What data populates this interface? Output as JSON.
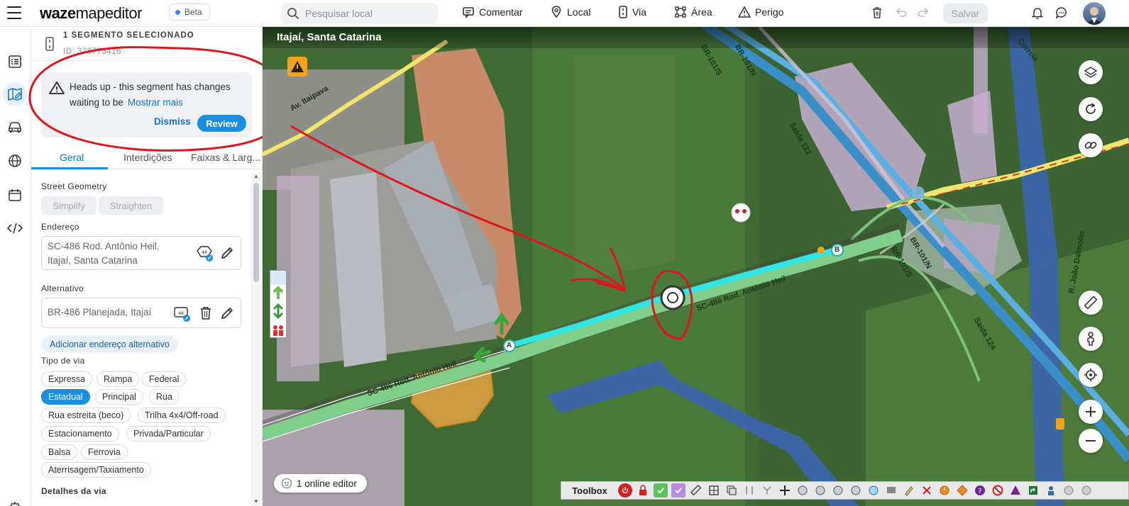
{
  "app": {
    "logo_bold": "waze",
    "logo_light": "mapeditor",
    "beta_label": "Beta"
  },
  "toolbar": {
    "search_placeholder": "Pesquisar local",
    "comment": "Comentar",
    "place": "Local",
    "road": "Via",
    "area": "Área",
    "hazard": "Perigo",
    "save": "Salvar"
  },
  "panel": {
    "selection_title": "1 SEGMENTO SELECIONADO",
    "selection_id": "ID: 378773416",
    "alert": {
      "text": "Heads up - this segment has changes waiting to be",
      "more": "Mostrar mais",
      "dismiss": "Dismiss",
      "review": "Review"
    },
    "tabs": [
      "Geral",
      "Interdições",
      "Faixas & Larg..."
    ],
    "street_geometry_label": "Street Geometry",
    "simplify": "Simplify",
    "straighten": "Straighten",
    "address_label": "Endereço",
    "address_line1": "SC-486 Rod. Antônio Heil,",
    "address_line2": "Itajaí, Santa Catarina",
    "alt_label": "Alternativo",
    "alt_value": "BR-486 Planejada, Itajaí",
    "add_alt": "Adicionar endereço alternativo",
    "road_type_label": "Tipo de via",
    "road_types": [
      "Expressa",
      "Rampa",
      "Federal",
      "Estadual",
      "Principal",
      "Rua",
      "Rua estreita (beco)",
      "Trilha 4x4/Off-road",
      "Estacionamento",
      "Privada/Particular",
      "Balsa",
      "Ferrovia",
      "Aterrisagem/Taxiamento"
    ],
    "selected_road_type": "Estadual",
    "details_label": "Detalhes da via"
  },
  "map": {
    "location": "Itajaí, Santa Catarina",
    "labels": {
      "main_road": "SC-486 Rod. Antônio Heil",
      "main_road_2": "SC-486 Rod. Antônio Heil",
      "br101s": "BR-101/S",
      "br101n": "BR-101/N",
      "saida122": "Saída 122",
      "saida124": "Saída 124",
      "av_itaipava": "Av. Itaipava",
      "r_correia": "Correia",
      "r_dalmolin": "R. João Dalmolin",
      "node_a": "A",
      "node_b": "B"
    },
    "online_editors": "1 online editor",
    "toolbox_label": "Toolbox"
  },
  "colors": {
    "accent": "#1a8fe0",
    "selected_segment": "#2ee6e6",
    "freeway": "#4aa6df",
    "major_highway": "#f2e56b",
    "annotation": "#e0141b"
  }
}
